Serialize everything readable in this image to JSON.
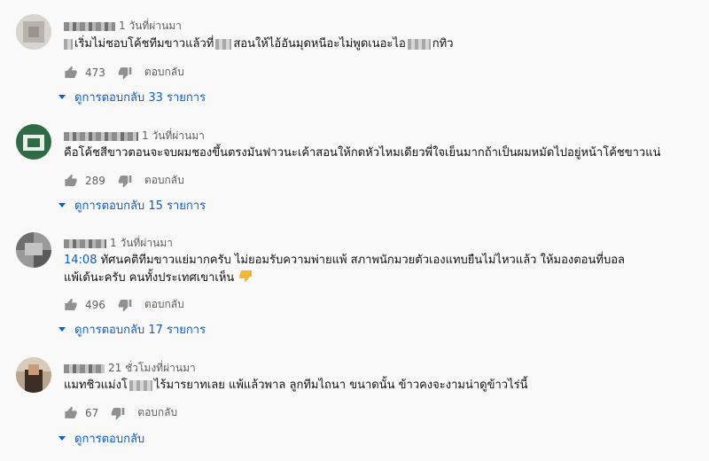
{
  "comments": [
    {
      "time": "1 วันที่ผ่านมา",
      "text_a": "เริ่มไม่ชอบโค้ชทีมขาวแล้วที่",
      "text_b": "สอนให้ไอ้อันมุดหนีอะไม่พูดเนอะไอ",
      "text_c": "กทิว",
      "likes": "473",
      "reply_label": "ตอบกลับ",
      "view_replies": "ดูการตอบกลับ 33 รายการ"
    },
    {
      "time": "1 วันที่ผ่านมา",
      "text": "คือโค้ชสีขาวตอนจะจบผมชองขึ้นตรงมันฟาวนะเค้าสอนให้กดหัวไหมเดียวพี่ใจเย็นมากถ้าเป็นผมหมัดไปอยู่หน้าโค้ชขาวแน่",
      "likes": "289",
      "reply_label": "ตอบกลับ",
      "view_replies": "ดูการตอบกลับ 15 รายการ"
    },
    {
      "time": "1 วันที่ผ่านมา",
      "timestamp": "14:08",
      "text": "ทัศนคติทีมขาวแย่มากครับ ไม่ยอมรับความพ่ายแพ้ สภาพนักมวยตัวเองแทบยืนไม่ไหวแล้ว ให้มองตอนที่บอลแพ้เด้นะครับ คนทั้งประเทศเขาเห็น",
      "likes": "496",
      "reply_label": "ตอบกลับ",
      "view_replies": "ดูการตอบกลับ 17 รายการ"
    },
    {
      "time": "21 ชั่วโมงที่ผ่านมา",
      "text_a": "แมทชิวแม่งโ",
      "text_b": "ไร้มารยาทเลย แพ้แล้วพาล ลูกทีมไถนา ขนาดนั้น ข้าวคงจะงามน่าดูข้าวไร่นี้",
      "likes": "67",
      "reply_label": "ตอบกลับ",
      "view_replies": "ดูการตอบกลับ"
    }
  ],
  "icons": {
    "like": "thumbs-up-icon",
    "dislike": "thumbs-down-icon",
    "emoji": "thumbs-down-emoji"
  },
  "colors": {
    "link": "#065fd4",
    "meta": "#606060"
  }
}
